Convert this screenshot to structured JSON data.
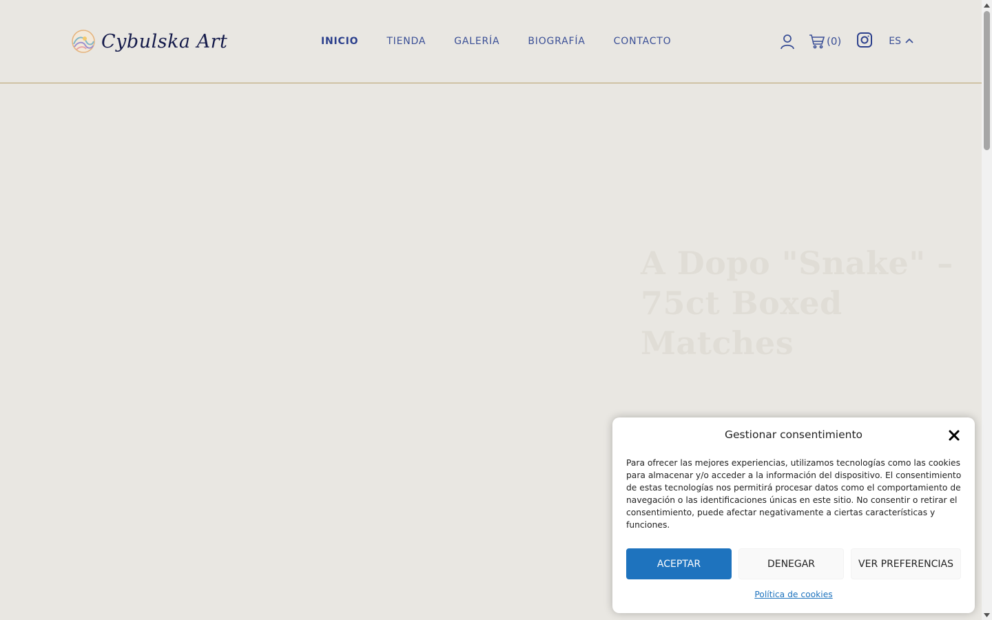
{
  "brand": {
    "name": "Cybulska Art"
  },
  "nav": {
    "items": [
      {
        "label": "INICIO",
        "active": true
      },
      {
        "label": "TIENDA",
        "active": false
      },
      {
        "label": "GALERÍA",
        "active": false
      },
      {
        "label": "BIOGRAFÍA",
        "active": false
      },
      {
        "label": "CONTACTO",
        "active": false
      }
    ]
  },
  "tools": {
    "account_icon": "user-icon",
    "cart_icon": "cart-icon",
    "cart_count": "(0)",
    "instagram_icon": "instagram-icon",
    "language": "ES",
    "language_icon": "chevron-up-icon"
  },
  "hero": {
    "title": "A Dopo \"Snake\" – 75ct Boxed Matches"
  },
  "consent": {
    "title": "Gestionar consentimiento",
    "text": "Para ofrecer las mejores experiencias, utilizamos tecnologías como las cookies para almacenar y/o acceder a la información del dispositivo. El consentimiento de estas tecnologías nos permitirá procesar datos como el comportamiento de navegación o las identificaciones únicas en este sitio. No consentir o retirar el consentimiento, puede afectar negativamente a ciertas características y funciones.",
    "accept_label": "ACEPTAR",
    "deny_label": "DENEGAR",
    "prefs_label": "VER PREFERENCIAS",
    "policy_link": "Política de cookies",
    "close_icon": "close-icon"
  },
  "colors": {
    "background": "#e9e7e2",
    "nav_text": "#3a4f96",
    "accent_line": "#b8a06a",
    "accept_button": "#1e73be"
  }
}
